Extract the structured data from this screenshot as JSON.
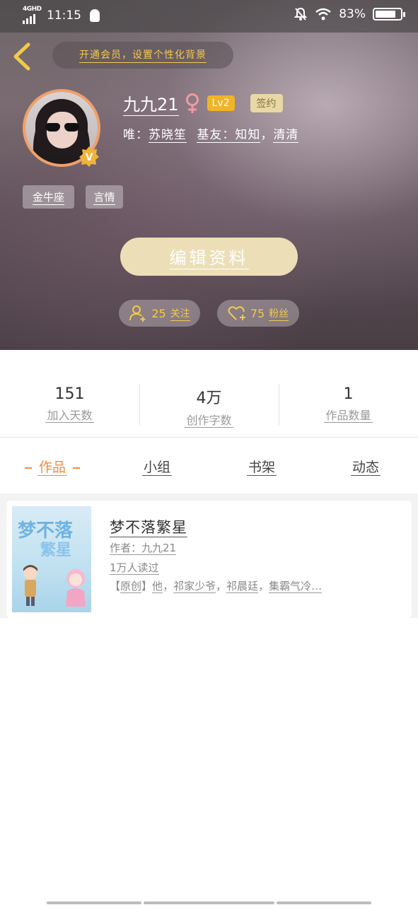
{
  "status_bar": {
    "network": "4GHD",
    "time": "11:15",
    "battery": "83%",
    "battery_level": 0.83
  },
  "header": {
    "vip_banner": "开通会员，设置个性化背景",
    "nickname": "九九21",
    "level": "Lv2",
    "sign_tag": "签约",
    "relation": {
      "prefix": "唯：",
      "partner": "苏晓笙",
      "friends_label": "基友：",
      "friend1": "知知",
      "sep": "，",
      "friend2": "清清"
    },
    "tags": [
      "金牛座",
      "言情"
    ],
    "edit_button": "编辑资料",
    "following": {
      "count": "25",
      "label": "关注"
    },
    "fans": {
      "count": "75",
      "label": "粉丝"
    }
  },
  "stats": [
    {
      "value": "151",
      "label": "加入天数"
    },
    {
      "value": "4万",
      "label": "创作字数"
    },
    {
      "value": "1",
      "label": "作品数量"
    }
  ],
  "tabs": [
    "作品",
    "小组",
    "书架",
    "动态"
  ],
  "works": [
    {
      "title": "梦不落繁星",
      "author": "作者：九九21",
      "readers": "1万人读过",
      "tag": "原创",
      "desc_1": "他",
      "desc_2": "祁家少爷",
      "desc_3": "祁晨廷",
      "desc_4": "集霸气冷…",
      "cover_title_1": "梦不落",
      "cover_title_2": "繁星"
    }
  ],
  "colors": {
    "accent": "#f08a3c",
    "gold": "#f2c94c",
    "button": "#ecdfb7"
  }
}
